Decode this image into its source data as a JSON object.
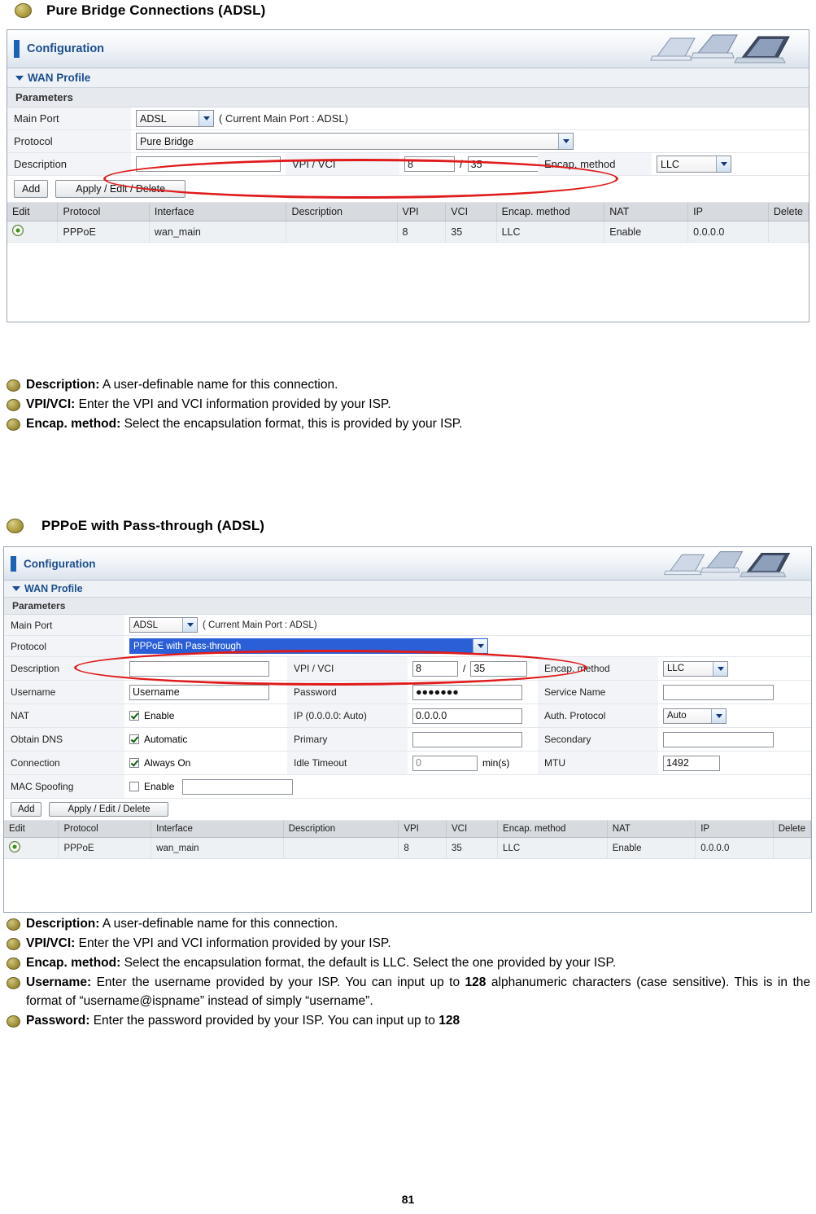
{
  "page": {
    "number": "81"
  },
  "section1": {
    "heading": "Pure Bridge Connections (ADSL)",
    "screenshot": {
      "header_title": "Configuration",
      "wan_profile": "WAN Profile",
      "parameters": "Parameters",
      "rows": {
        "main_port_label": "Main Port",
        "main_port_value": "ADSL",
        "main_port_note": "( Current Main Port : ADSL)",
        "protocol_label": "Protocol",
        "protocol_value": "Pure Bridge",
        "description_label": "Description",
        "description_value": "",
        "vpi_vci_label": "VPI / VCI",
        "vpi_value": "8",
        "vci_sep": "/",
        "vci_value": "35",
        "encap_label": "Encap. method",
        "encap_value": "LLC"
      },
      "buttons": {
        "add": "Add",
        "apply_edit_delete": "Apply / Edit / Delete"
      },
      "table": {
        "headers": [
          "Edit",
          "Protocol",
          "Interface",
          "Description",
          "VPI",
          "VCI",
          "Encap. method",
          "NAT",
          "IP",
          "Delete"
        ],
        "rows": [
          {
            "edit": "",
            "protocol": "PPPoE",
            "interface": "wan_main",
            "description": "",
            "vpi": "8",
            "vci": "35",
            "encap": "LLC",
            "nat": "Enable",
            "ip": "0.0.0.0",
            "delete": ""
          }
        ]
      }
    },
    "bullets": [
      {
        "label": "Description:",
        "text": " A user-definable name for this connection."
      },
      {
        "label": "VPI/VCI:",
        "text": " Enter the VPI and VCI information provided by your ISP."
      },
      {
        "label": "Encap. method:",
        "text": " Select the encapsulation format, this is provided by your ISP."
      }
    ]
  },
  "section2": {
    "heading": "PPPoE with Pass-through (ADSL)",
    "screenshot": {
      "header_title": "Configuration",
      "wan_profile": "WAN Profile",
      "parameters": "Parameters",
      "rows": {
        "main_port_label": "Main Port",
        "main_port_value": "ADSL",
        "main_port_note": "( Current Main Port : ADSL)",
        "protocol_label": "Protocol",
        "protocol_value": "PPPoE with Pass-through",
        "description_label": "Description",
        "description_value": "",
        "vpi_vci_label": "VPI / VCI",
        "vpi_value": "8",
        "vci_sep": "/",
        "vci_value": "35",
        "encap_label": "Encap. method",
        "encap_value": "LLC",
        "username_label": "Username",
        "username_value": "Username",
        "password_label": "Password",
        "password_value": "●●●●●●●",
        "service_name_label": "Service Name",
        "service_name_value": "",
        "nat_label": "NAT",
        "nat_checkbox_label": "Enable",
        "ip_label": "IP (0.0.0.0: Auto)",
        "ip_value": "0.0.0.0",
        "auth_protocol_label": "Auth. Protocol",
        "auth_protocol_value": "Auto",
        "obtain_dns_label": "Obtain DNS",
        "obtain_dns_checkbox_label": "Automatic",
        "primary_label": "Primary",
        "primary_value": "",
        "secondary_label": "Secondary",
        "secondary_value": "",
        "connection_label": "Connection",
        "connection_checkbox_label": "Always On",
        "idle_timeout_label": "Idle Timeout",
        "idle_timeout_value": "0",
        "idle_timeout_unit": "min(s)",
        "mtu_label": "MTU",
        "mtu_value": "1492",
        "mac_spoofing_label": "MAC Spoofing",
        "mac_spoofing_checkbox_label": "Enable",
        "mac_spoofing_value": ""
      },
      "buttons": {
        "add": "Add",
        "apply_edit_delete": "Apply / Edit / Delete"
      },
      "table": {
        "headers": [
          "Edit",
          "Protocol",
          "Interface",
          "Description",
          "VPI",
          "VCI",
          "Encap. method",
          "NAT",
          "IP",
          "Delete"
        ],
        "rows": [
          {
            "edit": "",
            "protocol": "PPPoE",
            "interface": "wan_main",
            "description": "",
            "vpi": "8",
            "vci": "35",
            "encap": "LLC",
            "nat": "Enable",
            "ip": "0.0.0.0",
            "delete": ""
          }
        ]
      }
    },
    "bullets": [
      {
        "label": "Description:",
        "text": " A user-definable name for this connection."
      },
      {
        "label": "VPI/VCI:",
        "text": " Enter the VPI and VCI information provided by your ISP."
      },
      {
        "label": "Encap. method:",
        "text": " Select the encapsulation format, the default is LLC. Select the one provided by your ISP."
      },
      {
        "label": "Username:",
        "text": " Enter the username provided by your ISP. You can input up to ",
        "bold_tail": "128",
        "text2": " alphanumeric characters (case sensitive). This is in the format of “username@ispname” instead of simply “username”."
      },
      {
        "label": "Password:",
        "text": " Enter the password provided by your ISP. You can input up to ",
        "bold_tail": "128"
      }
    ]
  }
}
